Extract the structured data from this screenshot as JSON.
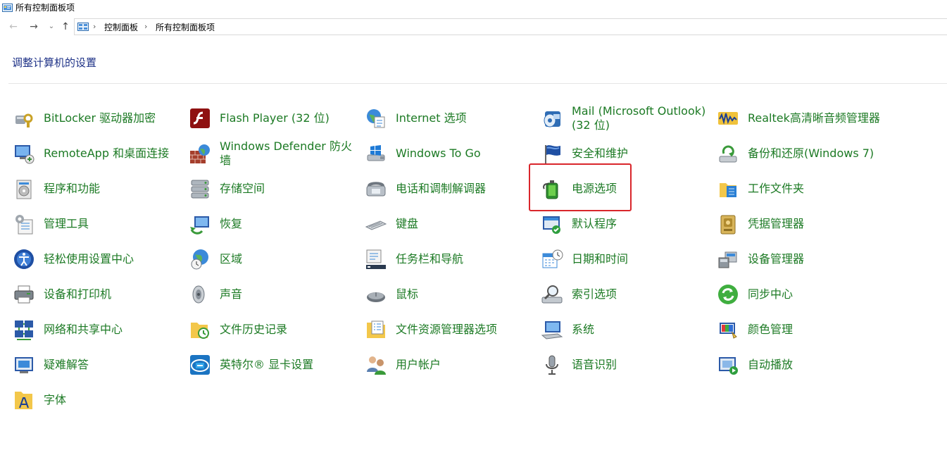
{
  "window": {
    "title": "所有控制面板项"
  },
  "nav": {
    "back": "←",
    "forward": "→",
    "recent": "⌄",
    "up": "↑",
    "breadcrumb": [
      "控制面板",
      "所有控制面板项"
    ],
    "separator": "›"
  },
  "heading": "调整计算机的设置",
  "highlight_color": "#d9262b",
  "items": [
    {
      "label": "BitLocker 驱动器加密",
      "icon": "bitlocker-icon"
    },
    {
      "label": "Flash Player (32 位)",
      "icon": "flash-player-icon"
    },
    {
      "label": "Internet 选项",
      "icon": "internet-options-icon"
    },
    {
      "label": "Mail (Microsoft Outlook) (32 位)",
      "icon": "mail-icon"
    },
    {
      "label": "Realtek高清晰音频管理器",
      "icon": "realtek-audio-icon"
    },
    {
      "label": "RemoteApp 和桌面连接",
      "icon": "remoteapp-icon"
    },
    {
      "label": "Windows Defender 防火墙",
      "icon": "firewall-icon"
    },
    {
      "label": "Windows To Go",
      "icon": "windows-to-go-icon"
    },
    {
      "label": "安全和维护",
      "icon": "security-flag-icon"
    },
    {
      "label": "备份和还原(Windows 7)",
      "icon": "backup-restore-icon"
    },
    {
      "label": "程序和功能",
      "icon": "programs-features-icon"
    },
    {
      "label": "存储空间",
      "icon": "storage-spaces-icon"
    },
    {
      "label": "电话和调制解调器",
      "icon": "phone-modem-icon"
    },
    {
      "label": "电源选项",
      "icon": "power-options-icon"
    },
    {
      "label": "工作文件夹",
      "icon": "work-folders-icon"
    },
    {
      "label": "管理工具",
      "icon": "admin-tools-icon"
    },
    {
      "label": "恢复",
      "icon": "recovery-icon"
    },
    {
      "label": "键盘",
      "icon": "keyboard-icon"
    },
    {
      "label": "默认程序",
      "icon": "default-programs-icon"
    },
    {
      "label": "凭据管理器",
      "icon": "credential-manager-icon"
    },
    {
      "label": "轻松使用设置中心",
      "icon": "ease-of-access-icon"
    },
    {
      "label": "区域",
      "icon": "region-icon"
    },
    {
      "label": "任务栏和导航",
      "icon": "taskbar-navigation-icon"
    },
    {
      "label": "日期和时间",
      "icon": "date-time-icon"
    },
    {
      "label": "设备管理器",
      "icon": "device-manager-icon"
    },
    {
      "label": "设备和打印机",
      "icon": "devices-printers-icon"
    },
    {
      "label": "声音",
      "icon": "sound-icon"
    },
    {
      "label": "鼠标",
      "icon": "mouse-icon"
    },
    {
      "label": "索引选项",
      "icon": "indexing-options-icon"
    },
    {
      "label": "同步中心",
      "icon": "sync-center-icon"
    },
    {
      "label": "网络和共享中心",
      "icon": "network-sharing-icon"
    },
    {
      "label": "文件历史记录",
      "icon": "file-history-icon"
    },
    {
      "label": "文件资源管理器选项",
      "icon": "explorer-options-icon"
    },
    {
      "label": "系统",
      "icon": "system-icon"
    },
    {
      "label": "颜色管理",
      "icon": "color-management-icon"
    },
    {
      "label": "疑难解答",
      "icon": "troubleshooting-icon"
    },
    {
      "label": "英特尔® 显卡设置",
      "icon": "intel-graphics-icon"
    },
    {
      "label": "用户帐户",
      "icon": "user-accounts-icon"
    },
    {
      "label": "语音识别",
      "icon": "speech-recognition-icon"
    },
    {
      "label": "自动播放",
      "icon": "autoplay-icon"
    },
    {
      "label": "字体",
      "icon": "fonts-icon"
    }
  ]
}
